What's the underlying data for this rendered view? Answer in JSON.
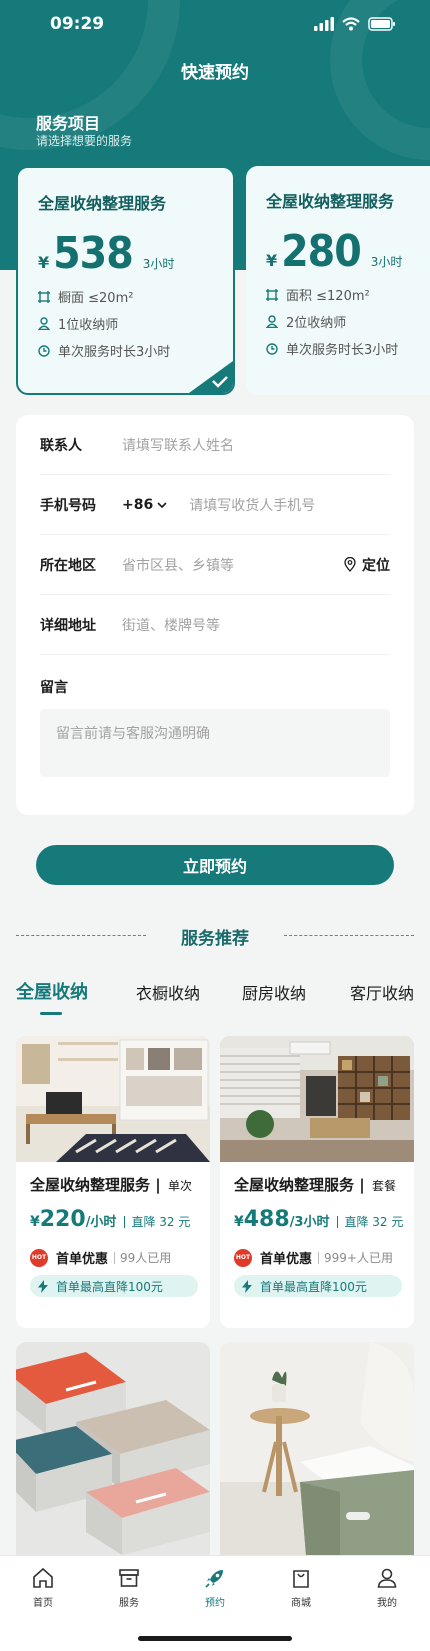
{
  "status": {
    "time": "09:29"
  },
  "header": {
    "title": "快速预约"
  },
  "services": {
    "title": "服务项目",
    "subtitle": "请选择想要的服务",
    "packages": [
      {
        "name": "全屋收纳整理服务",
        "currency": "¥",
        "price": "538",
        "unit": "3小时",
        "features": [
          "橱面 ≤20m²",
          "1位收纳师",
          "单次服务时长3小时"
        ],
        "selected": true
      },
      {
        "name": "全屋收纳整理服务",
        "currency": "¥",
        "price": "280",
        "unit": "3小时",
        "features": [
          "面积 ≤120m²",
          "2位收纳师",
          "单次服务时长3小时"
        ],
        "selected": false
      }
    ]
  },
  "form": {
    "contact": {
      "label": "联系人",
      "placeholder": "请填写联系人姓名"
    },
    "phone": {
      "label": "手机号码",
      "code": "+86",
      "placeholder": "请填写收货人手机号"
    },
    "region": {
      "label": "所在地区",
      "placeholder": "省市区县、乡镇等",
      "locate": "定位"
    },
    "address": {
      "label": "详细地址",
      "placeholder": "街道、楼牌号等"
    },
    "message": {
      "label": "留言",
      "placeholder": "留言前请与客服沟通明确"
    }
  },
  "submit_label": "立即预约",
  "recommend": {
    "title": "服务推荐",
    "tabs": [
      "全屋收纳",
      "衣橱收纳",
      "厨房收纳",
      "客厅收纳"
    ],
    "active_tab": 0,
    "cards": [
      {
        "name": "全屋收纳整理服务",
        "kind": "单次",
        "currency": "¥",
        "price": "220",
        "unit": "/小时",
        "discount": "直降 32 元",
        "promo": "首单优惠",
        "used": "99人已用",
        "coupon": "首单最高直降100元",
        "hot": "HOT"
      },
      {
        "name": "全屋收纳整理服务",
        "kind": "套餐",
        "currency": "¥",
        "price": "488",
        "unit": "/3小时",
        "discount": "直降 32 元",
        "promo": "首单优惠",
        "used": "999+人已用",
        "coupon": "首单最高直降100元",
        "hot": "HOT"
      }
    ]
  },
  "tabbar": {
    "items": [
      {
        "label": "首页",
        "icon": "home-icon"
      },
      {
        "label": "服务",
        "icon": "box-icon"
      },
      {
        "label": "预约",
        "icon": "rocket-icon"
      },
      {
        "label": "商城",
        "icon": "bag-icon"
      },
      {
        "label": "我的",
        "icon": "user-icon"
      }
    ],
    "active": 2
  },
  "colors": {
    "primary": "#167a7a",
    "card_bg": "#f0fafa",
    "hot": "#e03a2b",
    "coupon_bg": "#dff3f1"
  }
}
